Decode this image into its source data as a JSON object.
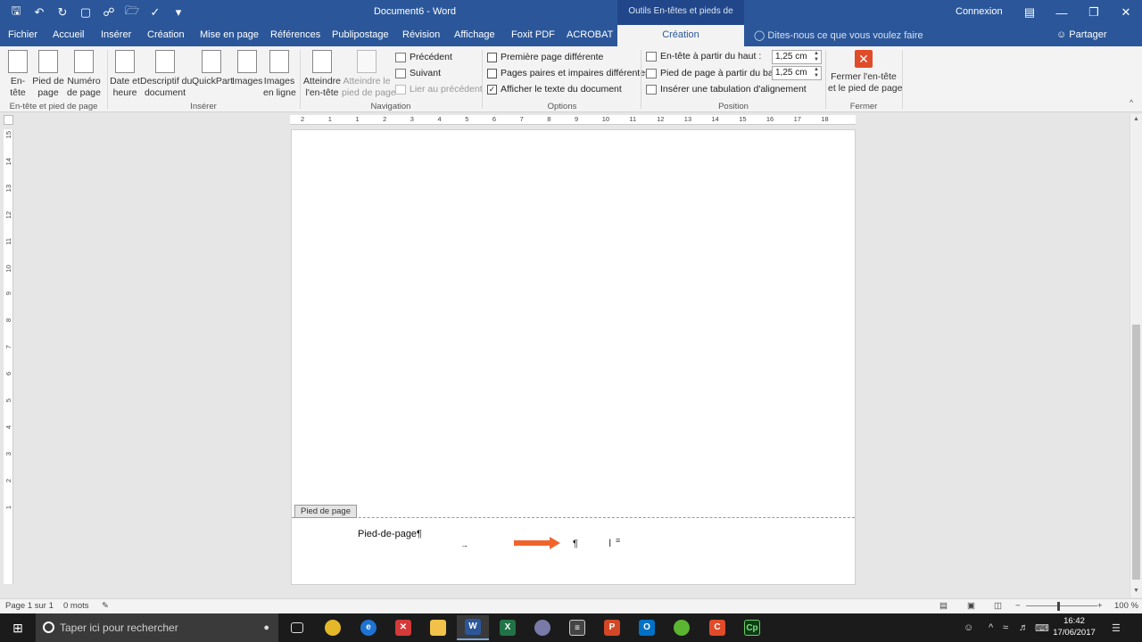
{
  "window": {
    "doc_title": "Document6 - Word",
    "context_title": "Outils En-têtes et pieds de page",
    "connexion": "Connexion",
    "qat_icons": [
      "save-icon",
      "undo-icon",
      "redo-icon",
      "print-preview-icon",
      "touch-mode-icon",
      "open-icon",
      "spelling-icon",
      "customize-icon"
    ]
  },
  "tabs": {
    "fichier": "Fichier",
    "accueil": "Accueil",
    "inserer": "Insérer",
    "creation": "Création",
    "mise_en_page": "Mise en page",
    "references": "Références",
    "publipostage": "Publipostage",
    "revision": "Révision",
    "affichage": "Affichage",
    "foxit": "Foxit PDF",
    "acrobat": "ACROBAT",
    "creation_context": "Création",
    "tell_me": "Dites-nous ce que vous voulez faire",
    "share": "Partager"
  },
  "ribbon": {
    "entete": "En-\ntête",
    "pied": "Pied de\npage",
    "numero": "Numéro\nde page",
    "date": "Date et\nheure",
    "descriptif": "Descriptif du\ndocument",
    "quickpart": "QuickPart",
    "images": "Images",
    "images_ligne": "Images\nen ligne",
    "atteindre_entete": "Atteindre\nl'en-tête",
    "atteindre_pied": "Atteindre le\npied de page",
    "precedent": "Précédent",
    "suivant": "Suivant",
    "lier": "Lier au précédent",
    "premiere_page": "Première page différente",
    "pages_paires": "Pages paires et impaires différentes",
    "afficher_texte": "Afficher le texte du document",
    "entete_haut": "En-tête à partir du haut :",
    "pied_bas": "Pied de page à partir du bas :",
    "entete_haut_val": "1,25 cm",
    "pied_bas_val": "1,25 cm",
    "inserer_tab": "Insérer une tabulation d'alignement",
    "fermer": "Fermer l'en-tête\net le pied de page",
    "groups": {
      "entete_pied": "En-tête et pied de page",
      "inserer": "Insérer",
      "navigation": "Navigation",
      "options": "Options",
      "position": "Position",
      "fermer": "Fermer"
    },
    "options_checked": [
      false,
      false,
      true
    ]
  },
  "ruler": {
    "h_labels": [
      "2",
      "1",
      "1",
      "2",
      "3",
      "4",
      "5",
      "6",
      "7",
      "8",
      "9",
      "10",
      "11",
      "12",
      "13",
      "14",
      "15",
      "16",
      "17",
      "18"
    ],
    "v_labels": [
      "15",
      "14",
      "13",
      "12",
      "11",
      "10",
      "9",
      "8",
      "7",
      "6",
      "5",
      "4",
      "3",
      "2",
      "1"
    ]
  },
  "document": {
    "footer_tag": "Pied de page",
    "footer_text": "Pied-de-page¶",
    "tab_mark": "→",
    "pilcrow": "¶",
    "arrow_color": "#f0642c"
  },
  "status": {
    "page": "Page 1 sur 1",
    "words": "0 mots",
    "zoom": "100 %"
  },
  "taskbar": {
    "search_placeholder": "Taper ici pour rechercher",
    "time": "16:42",
    "date": "17/06/2017"
  }
}
